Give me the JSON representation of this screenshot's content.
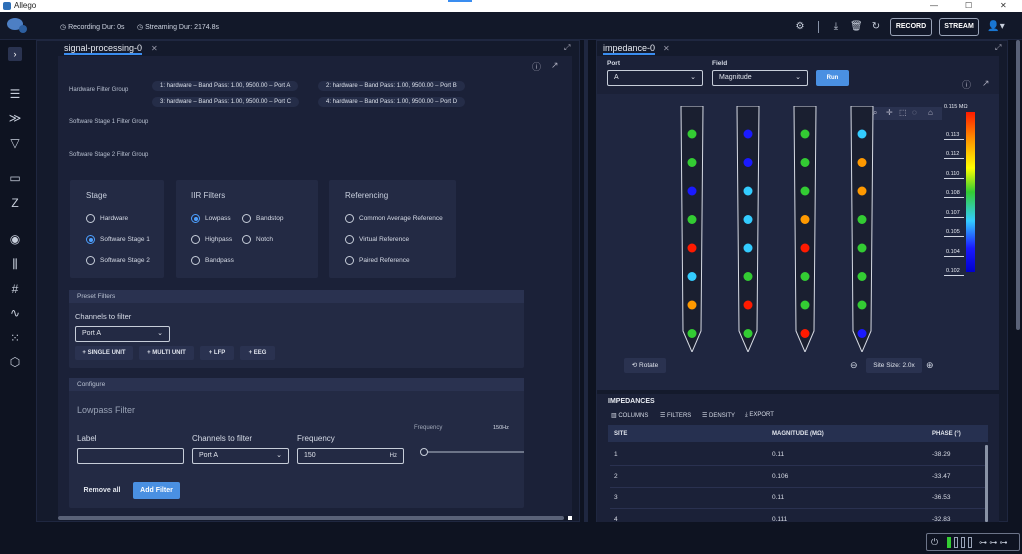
{
  "window": {
    "title": "Allego"
  },
  "header": {
    "recording": "Recording Dur: 0s",
    "streaming": "Streaming Dur: 2174.8s",
    "record_label": "RECORD",
    "stream_label": "STREAM"
  },
  "left_panel": {
    "tab": "signal-processing-0",
    "hardware_filter_group": "Hardware Filter Group",
    "chips": [
      "1: hardware – Band Pass: 1.00, 9500.00 – Port A",
      "2: hardware – Band Pass: 1.00, 9500.00 – Port B",
      "3: hardware – Band Pass: 1.00, 9500.00 – Port C",
      "4: hardware – Band Pass: 1.00, 9500.00 – Port D"
    ],
    "sw1": "Software Stage 1 Filter Group",
    "sw2": "Software Stage 2 Filter Group",
    "stage": {
      "title": "Stage",
      "options": [
        "Hardware",
        "Software Stage 1",
        "Software Stage 2"
      ],
      "selected": 1
    },
    "iir": {
      "title": "IIR Filters",
      "options": [
        "Lowpass",
        "Bandstop",
        "Highpass",
        "Notch",
        "Bandpass"
      ],
      "selected": 0
    },
    "ref": {
      "title": "Referencing",
      "options": [
        "Common Average Reference",
        "Virtual Reference",
        "Paired Reference"
      ]
    },
    "preset": {
      "title": "Preset Filters",
      "channels_label": "Channels to filter",
      "port": "Port A",
      "buttons": [
        "SINGLE UNIT",
        "MULTI UNIT",
        "LFP",
        "EEG"
      ]
    },
    "configure": {
      "title": "Configure",
      "filter_title": "Lowpass Filter",
      "label_label": "Label",
      "label_value": "",
      "channels_label": "Channels to filter",
      "channels_value": "Port A",
      "freq_label": "Frequency",
      "freq_value": "150",
      "freq_unit": "Hz",
      "slider_label": "Frequency",
      "slider_max": "150Hz",
      "remove": "Remove all",
      "add": "Add Filter"
    }
  },
  "right_panel": {
    "tab": "impedance-0",
    "port_label": "Port",
    "port_value": "A",
    "field_label": "Field",
    "field_value": "Magnitude",
    "run": "Run",
    "rotate": "Rotate",
    "site_size": "Site Size: 2.0x",
    "colorbar": {
      "unit": "MΩ",
      "ticks": [
        "0.115",
        "0.113",
        "0.112",
        "0.110",
        "0.108",
        "0.107",
        "0.105",
        "0.104",
        "0.102"
      ]
    },
    "probes": [
      [
        "#33cc33",
        "#33cc33",
        "#1a1aff",
        "#33cc33",
        "#ff1a00",
        "#33ccff",
        "#ff9900",
        "#33cc33"
      ],
      [
        "#1a1aff",
        "#1a1aff",
        "#33ccff",
        "#33ccff",
        "#33ccff",
        "#33cc33",
        "#ff1a00",
        "#33cc33"
      ],
      [
        "#33cc33",
        "#33cc33",
        "#33cc33",
        "#ff9900",
        "#ff1a00",
        "#33cc33",
        "#33cc33",
        "#ff1a00"
      ],
      [
        "#33ccff",
        "#ff9900",
        "#ff9900",
        "#33cc33",
        "#33cc33",
        "#33cc33",
        "#33cc33",
        "#1a1aff"
      ]
    ],
    "table": {
      "title": "IMPEDANCES",
      "toolbar": [
        "COLUMNS",
        "FILTERS",
        "DENSITY",
        "EXPORT"
      ],
      "headers": [
        "SITE",
        "MAGNITUDE (MΩ)",
        "PHASE (°)"
      ],
      "rows": [
        [
          "1",
          "0.11",
          "-38.29"
        ],
        [
          "2",
          "0.106",
          "-33.47"
        ],
        [
          "3",
          "0.11",
          "-36.53"
        ],
        [
          "4",
          "0.111",
          "-32.83"
        ]
      ]
    }
  }
}
